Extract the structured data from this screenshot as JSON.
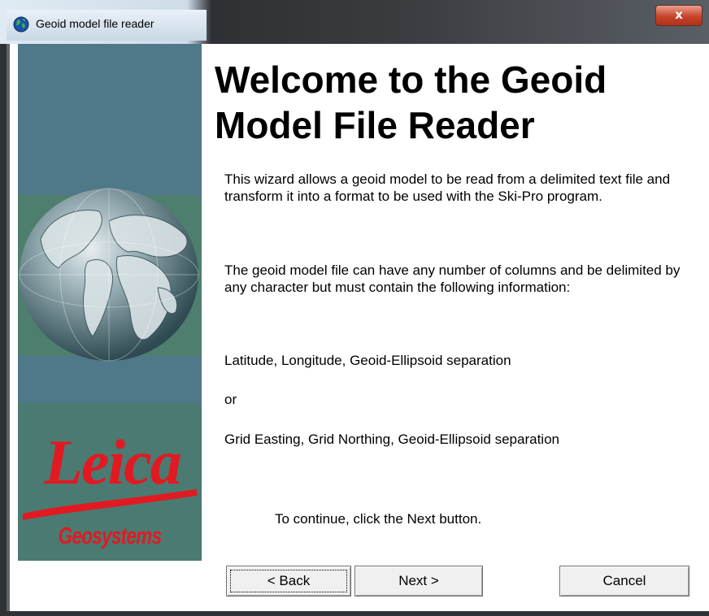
{
  "window": {
    "title": "Geoid model file reader",
    "close_label": "x"
  },
  "side_panel": {
    "logo_brand": "Leica",
    "logo_sub": "Geosystems"
  },
  "content": {
    "heading_line1": "Welcome to the Geoid",
    "heading_line2": "Model File Reader",
    "intro": "This wizard allows a geoid model to be read from a delimited text file and transform it into a format to be used with the Ski-Pro program.",
    "columns_info": "The geoid model file can have any number of columns and be delimited by any character but must contain the following information:",
    "option1": "Latitude, Longitude, Geoid-Ellipsoid separation",
    "or": "or",
    "option2": "Grid Easting, Grid Northing, Geoid-Ellipsoid separation",
    "continue_hint": "To continue, click the Next button."
  },
  "buttons": {
    "back": "< Back",
    "next": "Next >",
    "cancel": "Cancel"
  },
  "colors": {
    "panel_bg": "#4f7889",
    "logo_red": "#e11a22",
    "close_red": "#c8442a"
  }
}
